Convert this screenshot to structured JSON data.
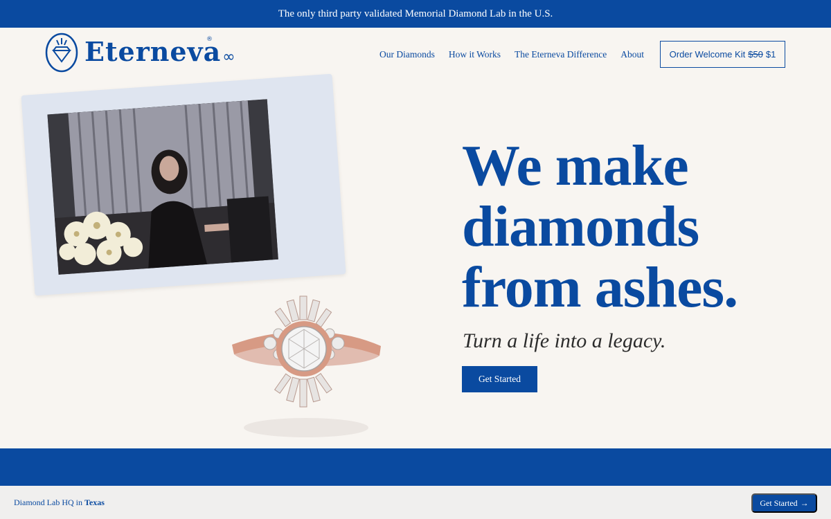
{
  "banner": {
    "text": "The only third party validated Memorial Diamond Lab in the U.S."
  },
  "brand": {
    "name": "Eterneva",
    "reg": "®",
    "infinity": "∞"
  },
  "nav": {
    "items": [
      "Our Diamonds",
      "How it Works",
      "The Eterneva Difference",
      "About"
    ],
    "order": {
      "label": "Order Welcome Kit",
      "old_price": "$50",
      "new_price": "$1"
    }
  },
  "hero": {
    "title_lines": [
      "We make",
      "diamonds",
      "from ashes."
    ],
    "tagline": "Turn a life into a legacy.",
    "cta": "Get Started"
  },
  "footer": {
    "prefix": "Diamond Lab HQ in",
    "location": "Texas",
    "cta": "Get Started",
    "cta_arrow": "→"
  },
  "colors": {
    "brand_blue": "#0a4aa0",
    "background": "#f8f5f1",
    "footer_bg": "#f0efee"
  }
}
